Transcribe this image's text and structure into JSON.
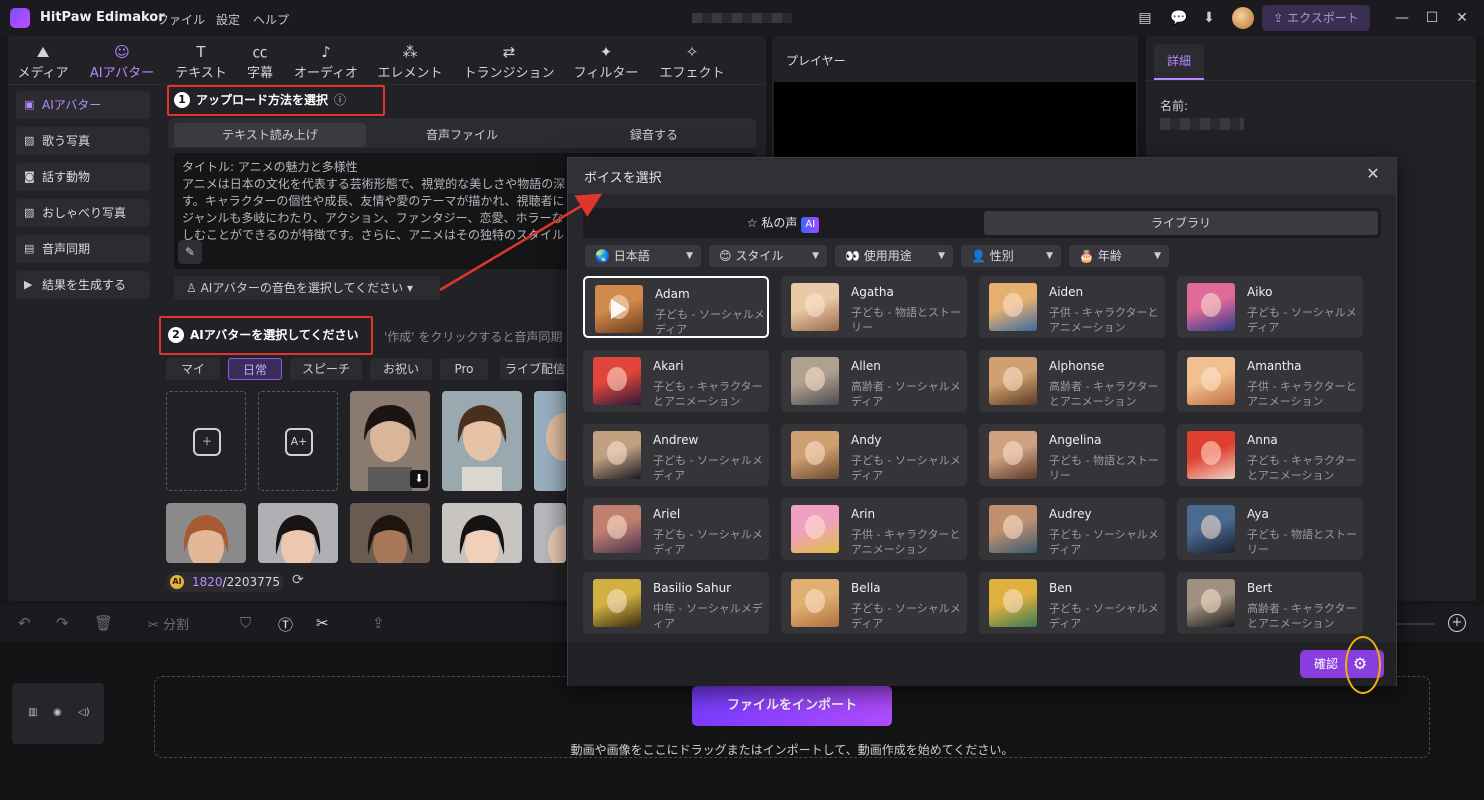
{
  "app": {
    "name": "HitPaw Edimakor",
    "menu": [
      "ファイル",
      "設定",
      "ヘルプ"
    ],
    "export_label": "エクスポート"
  },
  "tool_tabs": [
    {
      "label": "メディア",
      "icon": "media-icon"
    },
    {
      "label": "AIアバター",
      "icon": "ai-avatar-icon",
      "active": true
    },
    {
      "label": "テキスト",
      "icon": "text-icon"
    },
    {
      "label": "字幕",
      "icon": "subtitle-icon"
    },
    {
      "label": "オーディオ",
      "icon": "audio-icon"
    },
    {
      "label": "エレメント",
      "icon": "element-icon"
    },
    {
      "label": "トランジション",
      "icon": "transition-icon"
    },
    {
      "label": "フィルター",
      "icon": "filter-icon"
    },
    {
      "label": "エフェクト",
      "icon": "effect-icon"
    }
  ],
  "sidebar": {
    "items": [
      {
        "label": "AIアバター",
        "active": true
      },
      {
        "label": "歌う写真"
      },
      {
        "label": "話す動物"
      },
      {
        "label": "おしゃべり写真"
      },
      {
        "label": "音声同期"
      },
      {
        "label": "結果を生成する"
      }
    ]
  },
  "step1": {
    "num": "1",
    "label": "アップロード方法を選択",
    "tabs": [
      "テキスト読み上げ",
      "音声ファイル",
      "録音する"
    ],
    "script_lines": [
      "タイトル: アニメの魅力と多様性",
      "アニメは日本の文化を代表する芸術形態で、視覚的な美しさや物語の深",
      "す。キャラクターの個性や成長、友情や愛のテーマが描かれ、視聴者に",
      "ジャンルも多岐にわたり、アクション、ファンタジー、恋愛、ホラーな",
      "しむことができるのが特徴です。さらに、アニメはその独特のスタイル"
    ],
    "voice_select": "AIアバターの音色を選択してください"
  },
  "step2": {
    "num": "2",
    "label": "AIアバターを選択してください",
    "hint": "'作成' をクリックすると音声同期",
    "categories": [
      "マイ",
      "日常",
      "スピーチ",
      "お祝い",
      "Pro",
      "ライブ配信"
    ],
    "active_category": "日常"
  },
  "credits": {
    "used": "1820",
    "total": "/2203775"
  },
  "player": {
    "label": "プレイヤー"
  },
  "details": {
    "tab": "詳細",
    "name_label": "名前:"
  },
  "timeline": {
    "split_label": "分割",
    "import_button": "ファイルをインポート",
    "drop_hint": "動画や画像をここにドラッグまたはインポートして、動画作成を始めてください。"
  },
  "voice_modal": {
    "title": "ボイスを選択",
    "tab_my_voice": "私の声",
    "ai_badge": "AI",
    "tab_library": "ライブラリ",
    "filters": [
      {
        "label": "日本語",
        "icon": "globe-icon"
      },
      {
        "label": "スタイル",
        "icon": "smile-icon"
      },
      {
        "label": "使用用途",
        "icon": "eyes-icon"
      },
      {
        "label": "性別",
        "icon": "person-icon"
      },
      {
        "label": "年齢",
        "icon": "cake-icon"
      }
    ],
    "confirm_label": "確認",
    "voices": [
      {
        "name": "Adam",
        "desc": "子ども - ソーシャルメディア",
        "selected": true,
        "colors": [
          "#d08a4a",
          "#6b3b1f"
        ]
      },
      {
        "name": "Agatha",
        "desc": "子ども - 物語とストーリー",
        "colors": [
          "#e9c9a6",
          "#9a6a4a"
        ]
      },
      {
        "name": "Aiden",
        "desc": "子供 - キャラクターとアニメーション",
        "colors": [
          "#e8b070",
          "#3a6aa0"
        ]
      },
      {
        "name": "Aiko",
        "desc": "子ども - ソーシャルメディア",
        "colors": [
          "#e06a9a",
          "#2a3a8a"
        ]
      },
      {
        "name": "Akari",
        "desc": "子ども - キャラクターとアニメーション",
        "colors": [
          "#e0443a",
          "#2a1a3a"
        ]
      },
      {
        "name": "Allen",
        "desc": "高齢者 - ソーシャルメディア",
        "colors": [
          "#b0a090",
          "#4a4a50"
        ]
      },
      {
        "name": "Alphonse",
        "desc": "高齢者 - キャラクターとアニメーション",
        "colors": [
          "#d0a070",
          "#5a3a20"
        ]
      },
      {
        "name": "Amantha",
        "desc": "子供 - キャラクターとアニメーション",
        "colors": [
          "#f0c090",
          "#c07040"
        ]
      },
      {
        "name": "Andrew",
        "desc": "子ども - ソーシャルメディア",
        "colors": [
          "#c0a080",
          "#1a1a24"
        ]
      },
      {
        "name": "Andy",
        "desc": "子ども - ソーシャルメディア",
        "colors": [
          "#d0a070",
          "#6a4a30"
        ]
      },
      {
        "name": "Angelina",
        "desc": "子ども - 物語とストーリー",
        "colors": [
          "#d0a080",
          "#5a3a2a"
        ]
      },
      {
        "name": "Anna",
        "desc": "子ども - キャラクターとアニメーション",
        "colors": [
          "#e04030",
          "#f0d0c0"
        ]
      },
      {
        "name": "Ariel",
        "desc": "子ども - ソーシャルメディア",
        "colors": [
          "#c08070",
          "#4a3050"
        ]
      },
      {
        "name": "Arin",
        "desc": "子供 - キャラクターとアニメーション",
        "colors": [
          "#f0a0c0",
          "#e0c040"
        ]
      },
      {
        "name": "Audrey",
        "desc": "子ども - ソーシャルメディア",
        "colors": [
          "#c09070",
          "#3a5a70"
        ]
      },
      {
        "name": "Aya",
        "desc": "子ども - 物語とストーリー",
        "colors": [
          "#4a6a90",
          "#1a2030"
        ]
      },
      {
        "name": "Basilio Sahur",
        "desc": "中年 - ソーシャルメディア",
        "colors": [
          "#d0b040",
          "#3a2a10"
        ]
      },
      {
        "name": "Bella",
        "desc": "子ども - ソーシャルメディア",
        "colors": [
          "#e0b070",
          "#b07040"
        ]
      },
      {
        "name": "Ben",
        "desc": "子ども - ソーシャルメディア",
        "colors": [
          "#e0b040",
          "#3a7a50"
        ]
      },
      {
        "name": "Bert",
        "desc": "高齢者 - キャラクターとアニメーション",
        "colors": [
          "#a09080",
          "#1a1a1a"
        ]
      }
    ]
  },
  "colors": {
    "accent": "#b58cff",
    "annotation_red": "#e0352b",
    "annotation_yellow": "#f0b400"
  }
}
